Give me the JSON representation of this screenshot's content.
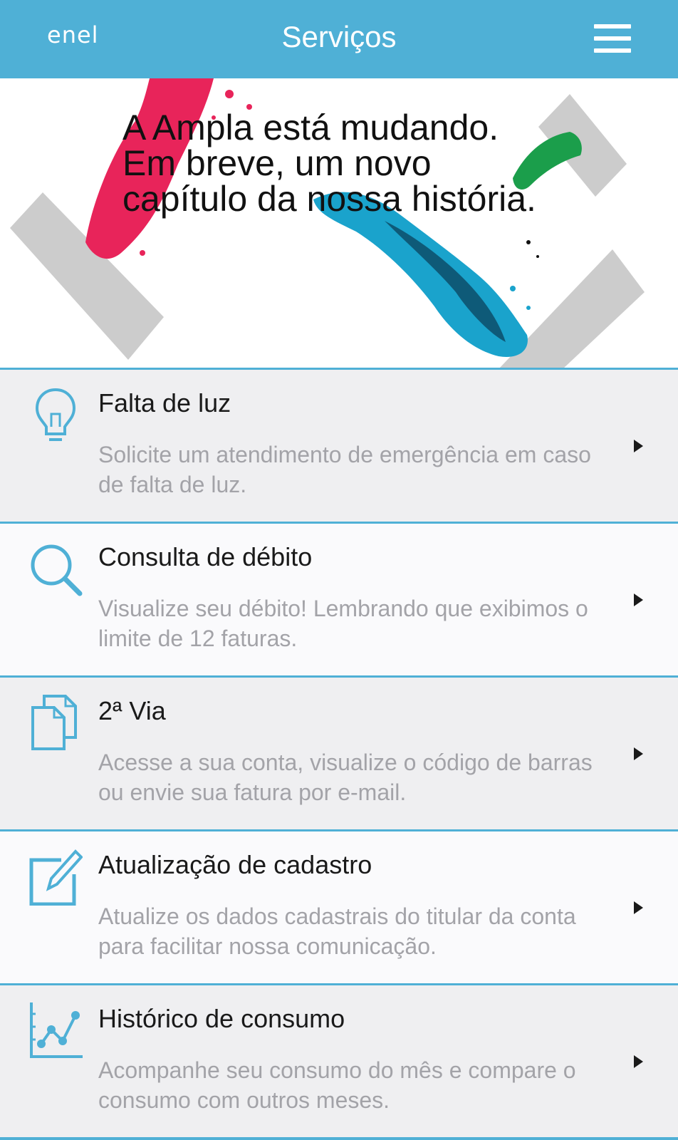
{
  "header": {
    "logo": "enel",
    "title": "Serviços",
    "menu_icon": "hamburger-menu-icon"
  },
  "banner": {
    "text": "A Ampla está mudando.\nEm breve, um novo\ncapítulo da nossa história.",
    "colors": {
      "pink": "#e8245a",
      "blue": "#1aa3cc",
      "green": "#1b9e4b",
      "gray": "#cccccc"
    }
  },
  "services": [
    {
      "title": "Falta de luz",
      "description": "Solicite um atendimento de emergência em caso de falta de luz.",
      "icon": "lightbulb-icon"
    },
    {
      "title": "Consulta de débito",
      "description": "Visualize seu débito! Lembrando que exibimos o limite de 12 faturas.",
      "icon": "search-icon"
    },
    {
      "title": "2ª Via",
      "description": "Acesse a sua conta, visualize o código de barras ou envie sua fatura por e-mail.",
      "icon": "documents-icon"
    },
    {
      "title": "Atualização de cadastro",
      "description": "Atualize os dados cadastrais do titular da conta para facilitar nossa comunicação.",
      "icon": "edit-icon"
    },
    {
      "title": "Histórico de consumo",
      "description": "Acompanhe seu consumo do mês e compare o consumo com outros meses.",
      "icon": "line-chart-icon"
    }
  ],
  "colors": {
    "accent": "#4fb0d6",
    "row_shade": "#efeff1",
    "row_light": "#fafafc",
    "description_text": "#a3a3a8"
  }
}
